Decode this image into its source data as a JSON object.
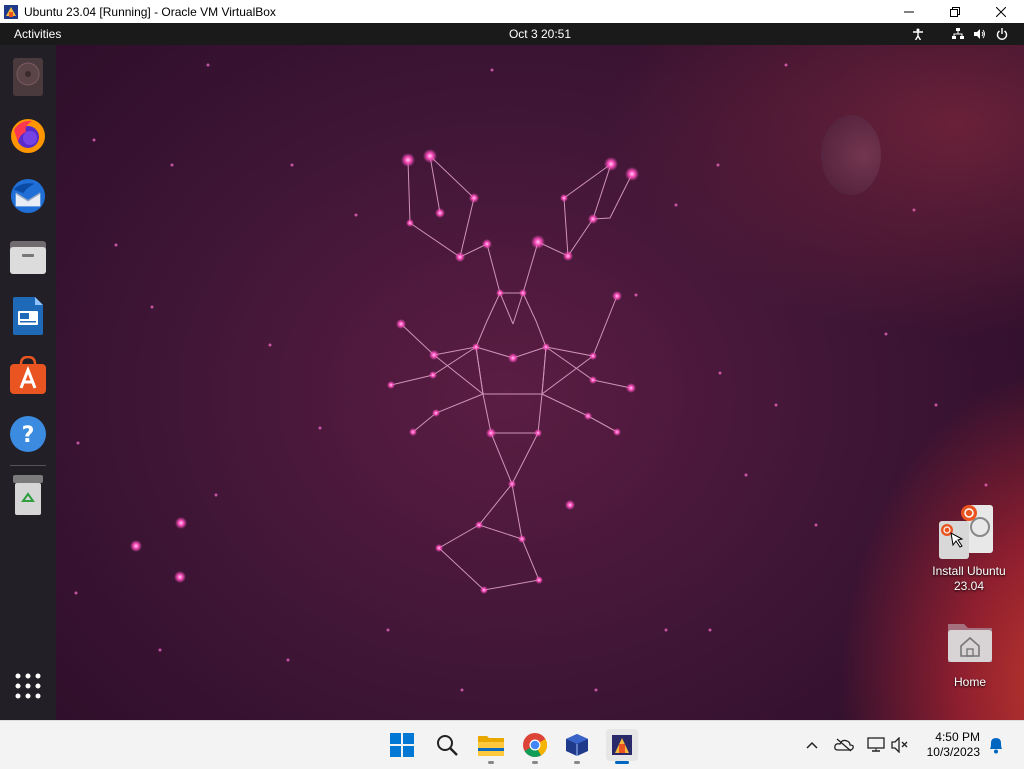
{
  "window": {
    "title": "Ubuntu 23.04 [Running] - Oracle VM VirtualBox",
    "controls": [
      "minimize-icon",
      "restore-icon",
      "close-icon"
    ]
  },
  "topbar": {
    "activities": "Activities",
    "clock": "Oct 3  20:51",
    "tray_icons": [
      "accessibility-icon",
      "network-icon",
      "volume-icon",
      "power-icon"
    ]
  },
  "dock": {
    "items": [
      {
        "name": "rhythmbox",
        "icon": "rhythmbox-icon"
      },
      {
        "name": "firefox",
        "icon": "firefox-icon"
      },
      {
        "name": "thunderbird",
        "icon": "thunderbird-icon"
      },
      {
        "name": "files",
        "icon": "files-icon"
      },
      {
        "name": "libreoffice-writer",
        "icon": "writer-icon"
      },
      {
        "name": "app-center",
        "icon": "app-center-icon"
      },
      {
        "name": "help",
        "icon": "help-icon"
      },
      {
        "name": "trash",
        "icon": "trash-icon"
      }
    ],
    "show_apps_icon": "app-grid-icon"
  },
  "desktop": {
    "icons": [
      {
        "label": "Install Ubuntu 23.04",
        "icon": "install-ubuntu-icon"
      },
      {
        "label": "Home",
        "icon": "home-folder-icon"
      }
    ]
  },
  "taskbar": {
    "apps": [
      "windows-start-icon",
      "search-icon",
      "file-explorer-icon",
      "chrome-icon",
      "virtualbox-icon",
      "virtualbox-vm-icon"
    ],
    "tray_icons": [
      "chevron-up-icon",
      "onedrive-icon",
      "network-icon",
      "speaker-muted-icon"
    ],
    "time": "4:50 PM",
    "date": "10/3/2023",
    "notification_icon": "bell-icon"
  },
  "colors": {
    "ubuntu_orange": "#E95420",
    "wallpaper_base": "#3e1535",
    "constellation": "#ff5fc8"
  }
}
